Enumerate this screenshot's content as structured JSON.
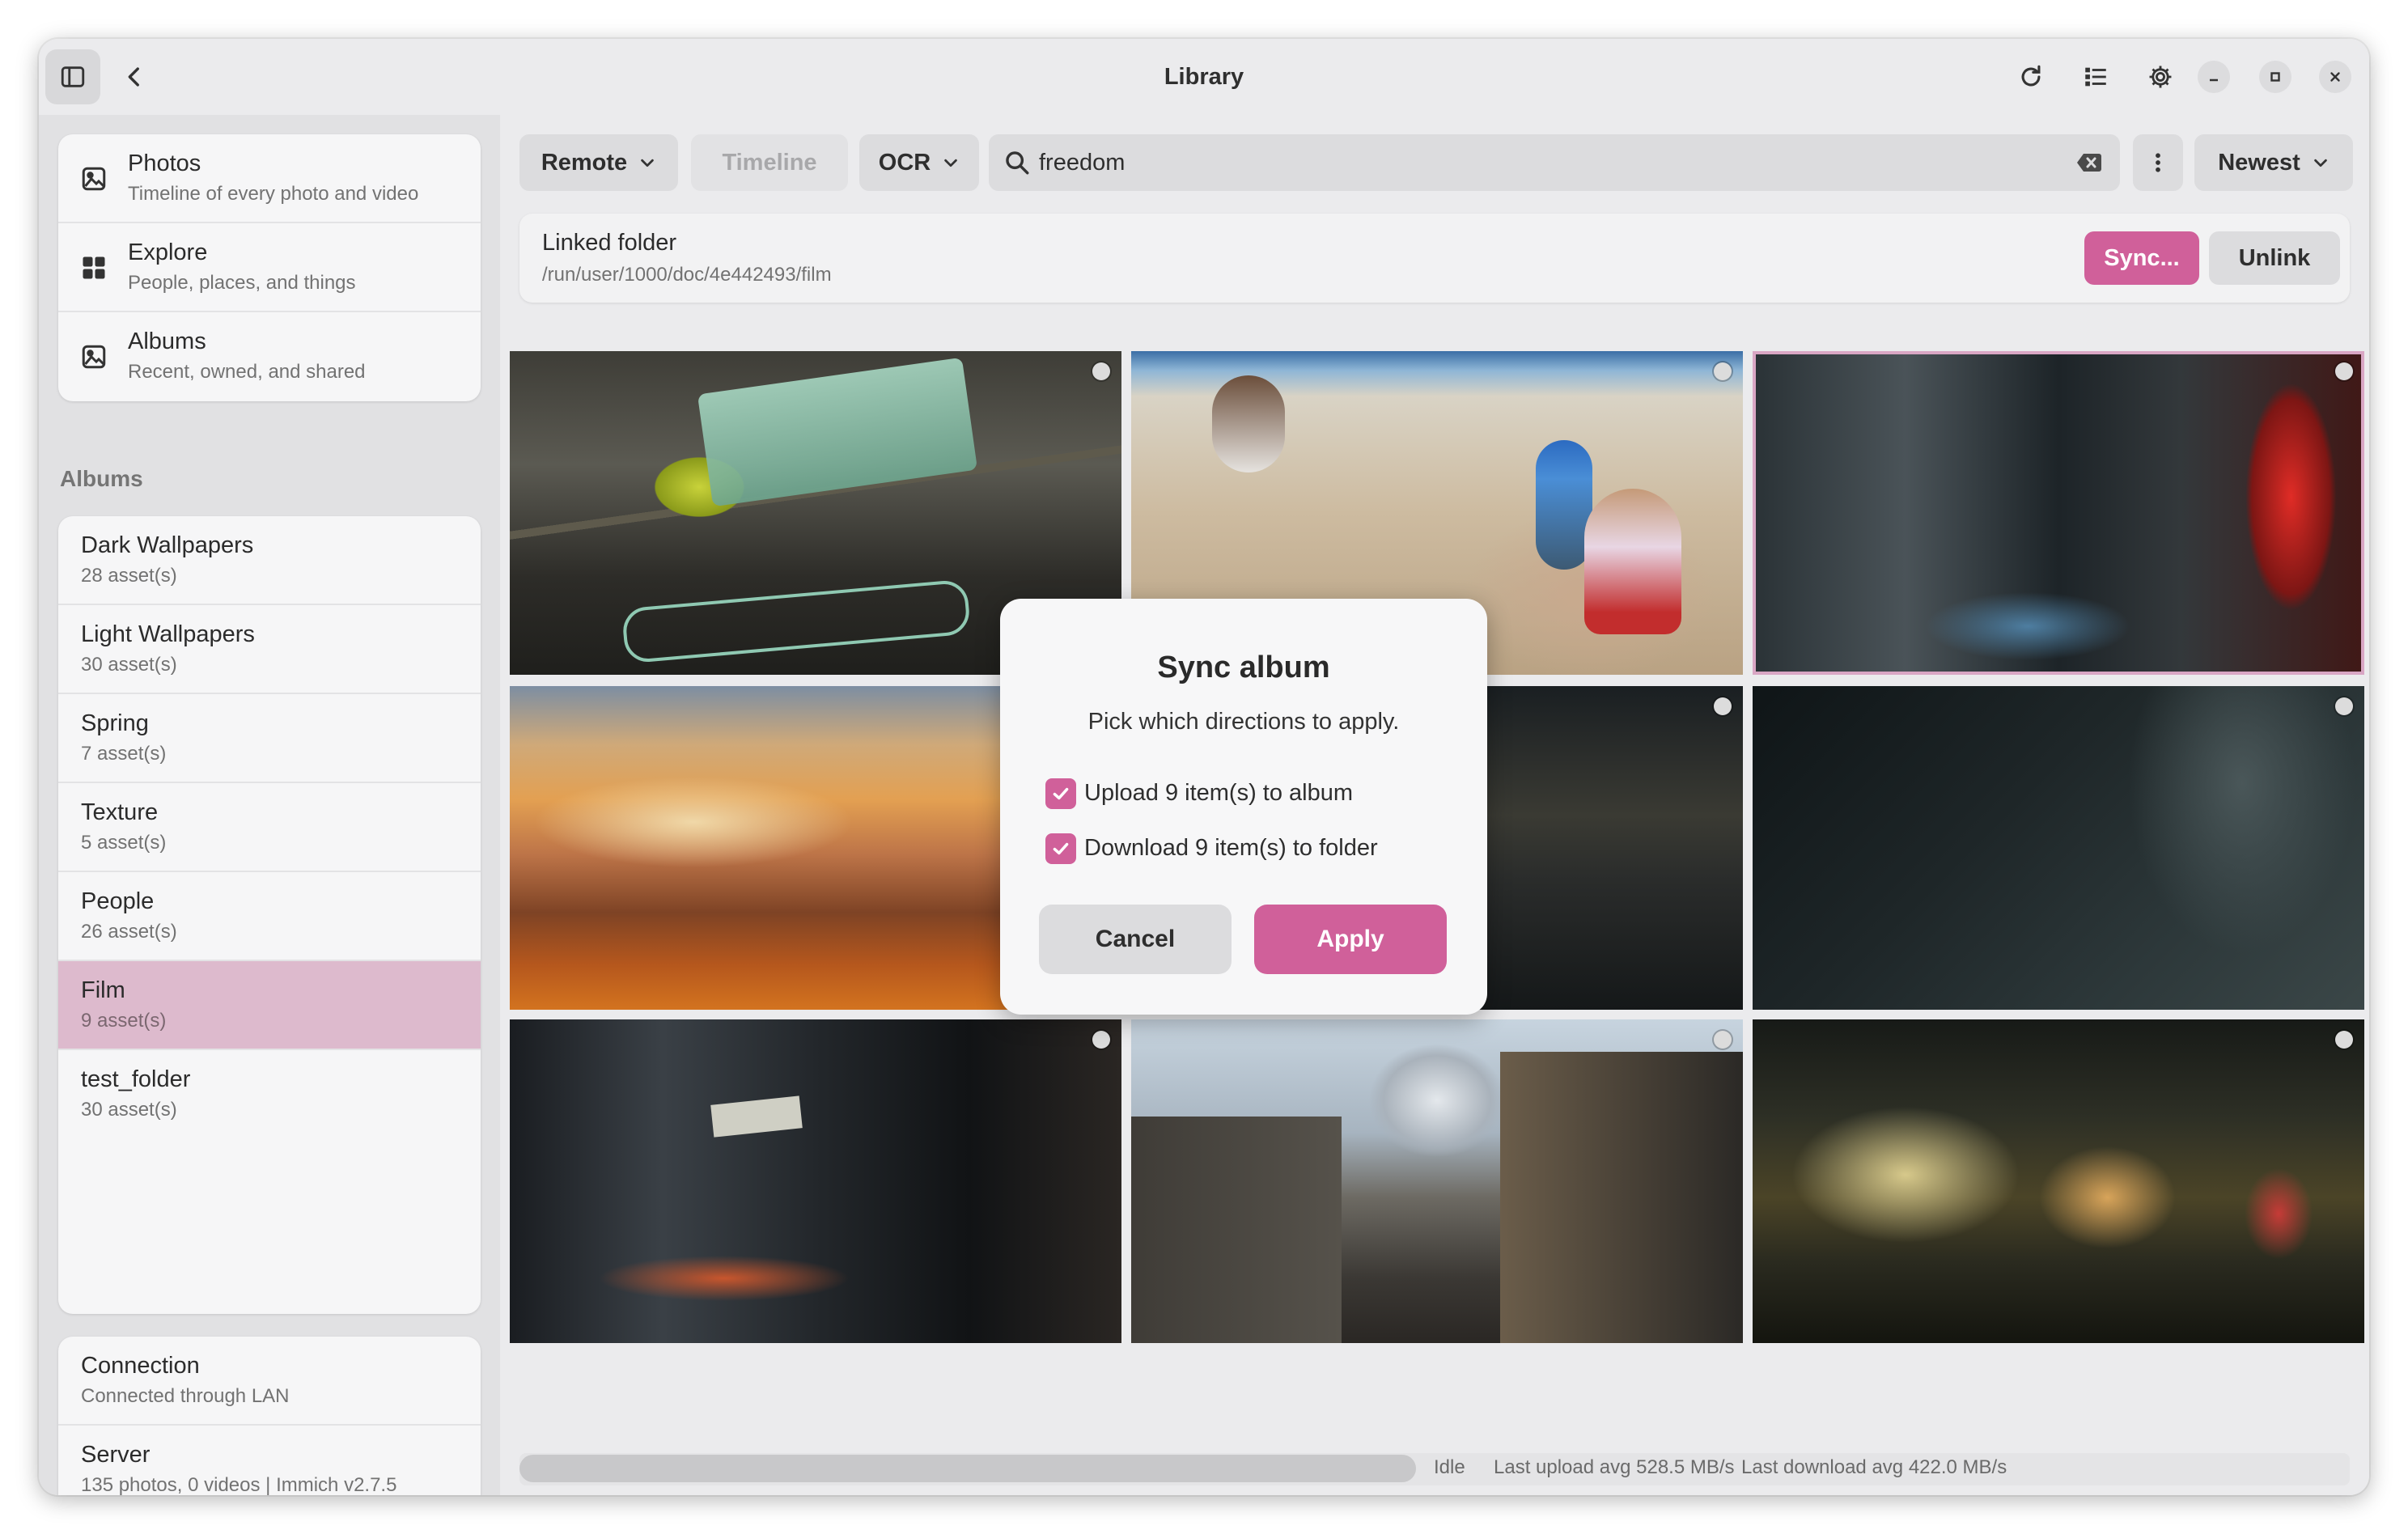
{
  "window": {
    "title": "Library"
  },
  "nav": [
    {
      "label": "Photos",
      "sublabel": "Timeline of every photo and video",
      "icon": "image-icon"
    },
    {
      "label": "Explore",
      "sublabel": "People, places, and things",
      "icon": "grid-icon"
    },
    {
      "label": "Albums",
      "sublabel": "Recent, owned, and shared",
      "icon": "image-icon"
    }
  ],
  "albums_heading": "Albums",
  "albums": [
    {
      "name": "Dark Wallpapers",
      "count": "28 asset(s)"
    },
    {
      "name": "Light Wallpapers",
      "count": "30 asset(s)"
    },
    {
      "name": "Spring",
      "count": "7 asset(s)"
    },
    {
      "name": "Texture",
      "count": "5 asset(s)"
    },
    {
      "name": "People",
      "count": "26 asset(s)"
    },
    {
      "name": "Film",
      "count": "9 asset(s)",
      "selected": true
    },
    {
      "name": "test_folder",
      "count": "30 asset(s)"
    }
  ],
  "footer": {
    "connection_label": "Connection",
    "connection_value": "Connected through LAN",
    "server_label": "Server",
    "server_value": "135 photos, 0 videos | Immich v2.7.5"
  },
  "toolbar": {
    "source": "Remote",
    "timeline": "Timeline",
    "search_mode": "OCR",
    "search_value": "freedom",
    "sort": "Newest"
  },
  "linked": {
    "label": "Linked folder",
    "path": "/run/user/1000/doc/4e442493/film",
    "sync_label": "Sync...",
    "unlink_label": "Unlink"
  },
  "photos": [
    {
      "desc": "melt-sign"
    },
    {
      "desc": "beach-kids"
    },
    {
      "desc": "city-night"
    },
    {
      "desc": "mountain-sunset"
    },
    {
      "desc": "rainy-street"
    },
    {
      "desc": "foggy-city"
    },
    {
      "desc": "bar-street"
    },
    {
      "desc": "fuji-street"
    },
    {
      "desc": "station-night"
    }
  ],
  "status": {
    "state": "Idle",
    "upload": "Last upload avg 528.5 MB/s",
    "download": "Last download avg 422.0 MB/s",
    "progress": 0
  },
  "dialog": {
    "title": "Sync album",
    "body": "Pick which directions to apply.",
    "upload_option": "Upload 9 item(s) to album",
    "download_option": "Download 9 item(s) to folder",
    "cancel": "Cancel",
    "apply": "Apply"
  },
  "colors": {
    "accent": "#d0609a",
    "selected_row": "#ddbacd"
  }
}
